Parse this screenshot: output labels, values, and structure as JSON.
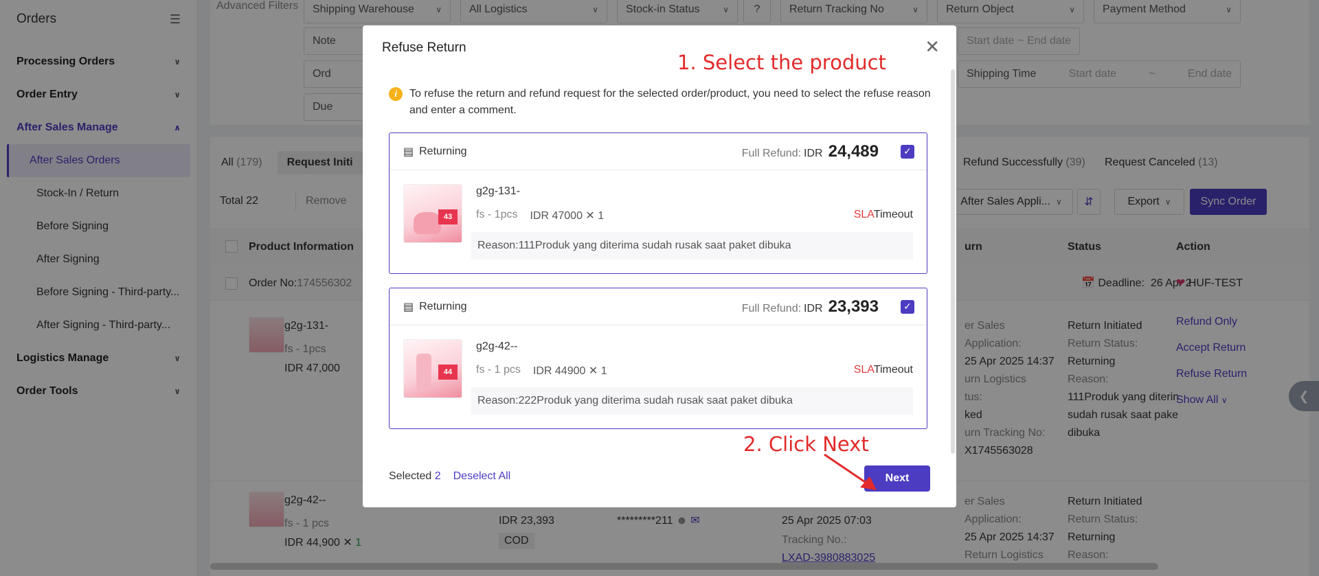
{
  "sidebar": {
    "title": "Orders",
    "groups": [
      {
        "label": "Processing Orders"
      },
      {
        "label": "Order Entry"
      },
      {
        "label": "After Sales Manage",
        "items": [
          {
            "label": "After Sales Orders"
          },
          {
            "label": "Stock-In / Return"
          },
          {
            "label": "Before Signing"
          },
          {
            "label": "After Signing"
          },
          {
            "label": "Before Signing - Third-party..."
          },
          {
            "label": "After Signing - Third-party..."
          }
        ]
      },
      {
        "label": "Logistics Manage"
      },
      {
        "label": "Order Tools"
      }
    ]
  },
  "filters": {
    "label": "Advanced Filters",
    "shipping_warehouse": "Shipping Warehouse",
    "logistics": "All Logistics",
    "stock_in_status": "Stock-in Status",
    "return_tracking": "Return Tracking No",
    "return_object": "Return Object",
    "payment_method": "Payment Method",
    "note": "Note",
    "order": "Ord",
    "due": "Due",
    "start_date": "Start date",
    "end_date": "End date",
    "tilde": "~",
    "shipping_time": "Shipping Time"
  },
  "tabs": [
    {
      "label": "All",
      "count": "(179)"
    },
    {
      "label": "Request Initi",
      "count": ""
    },
    {
      "label": "Refund Successfully",
      "count": "(39)"
    },
    {
      "label": "Request Canceled",
      "count": "(13)"
    }
  ],
  "toolbar": {
    "total": "Total 22",
    "remove": "Remove",
    "sort": "After Sales Appli...",
    "export": "Export",
    "sync": "Sync Order"
  },
  "table": {
    "headers": {
      "product": "Product Information",
      "return": "urn",
      "status": "Status",
      "action": "Action"
    },
    "order_no_label": "Order No:",
    "order_no": "174556302",
    "deadline_label": "Deadline:",
    "deadline": "26 Apr 2",
    "store": "HUF-TEST",
    "rows": [
      {
        "name": "g2g-131-",
        "spec": "fs - 1pcs",
        "price": "IDR 47,000",
        "return_lines": [
          "er Sales",
          "Application:",
          "25 Apr 2025 14:37",
          "urn Logistics",
          "tus:",
          "ked",
          "urn Tracking No:",
          "X1745563028"
        ],
        "status_lines": [
          "Return Initiated",
          "Return Status:",
          "Returning",
          "Reason:",
          "111Produk yang diterin",
          "sudah rusak saat pake",
          "dibuka"
        ]
      },
      {
        "name": "g2g-42--",
        "spec": "fs - 1 pcs",
        "price": "IDR 44,900",
        "qty": "1",
        "amount": "IDR 23,393",
        "payment": "COD",
        "buyer": "*********211",
        "date": "25 Apr 2025 07:03",
        "tracking_label": "Tracking No.:",
        "tracking": "LXAD-3980883025",
        "return_lines": [
          "er Sales",
          "Application:",
          "25 Apr 2025 14:37",
          "Return Logistics"
        ],
        "status_lines": [
          "Return Initiated",
          "Return Status:",
          "Returning",
          "Reason:"
        ]
      }
    ],
    "actions": [
      "Refund Only",
      "Accept Return",
      "Refuse Return",
      "Show All"
    ]
  },
  "modal": {
    "title": "Refuse Return",
    "info": "To refuse the return and refund request for the selected order/product, you need to select the refuse reason and enter a comment.",
    "cards": [
      {
        "status": "Returning",
        "refund_label": "Full Refund:",
        "currency": "IDR",
        "amount": "24,489",
        "name": "g2g-131-",
        "spec": "fs - 1pcs",
        "price": "IDR 47000",
        "qty": "1",
        "sla": "SLA",
        "timeout": "Timeout",
        "reason": "Reason:111Produk yang diterima sudah rusak saat paket dibuka"
      },
      {
        "status": "Returning",
        "refund_label": "Full Refund:",
        "currency": "IDR",
        "amount": "23,393",
        "name": "g2g-42--",
        "spec": "fs - 1 pcs",
        "price": "IDR 44900",
        "qty": "1",
        "sla": "SLA",
        "timeout": "Timeout",
        "reason": "Reason:222Produk yang diterima sudah rusak saat paket dibuka"
      }
    ],
    "selected_label": "Selected",
    "selected_count": "2",
    "deselect": "Deselect All",
    "next": "Next"
  },
  "annotations": {
    "step1": "1. Select the product",
    "step2": "2. Click Next"
  },
  "colors": {
    "accent": "#4b3cc1",
    "annotation": "#e22a2a",
    "warning": "#f6b21a",
    "sla": "#e23b3b"
  }
}
